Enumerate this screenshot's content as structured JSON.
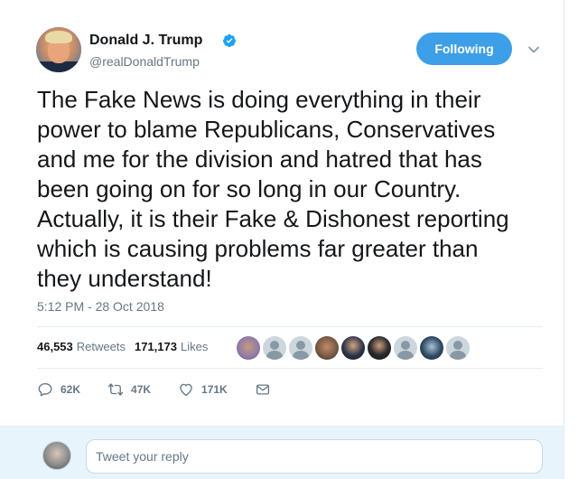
{
  "author": {
    "name": "Donald J. Trump",
    "handle": "@realDonaldTrump",
    "verified_icon": "verified-badge-icon"
  },
  "follow_button": {
    "label": "Following"
  },
  "tweet": {
    "lines": [
      "The Fake News is doing everything in their",
      "power to blame Republicans, Conservatives",
      "and me for the division and hatred that has",
      "been going on for so long in our Country.",
      "Actually, it is their Fake & Dishonest reporting",
      "which is causing problems far greater than",
      "they understand!"
    ],
    "timestamp": "5:12 PM - 28 Oct 2018"
  },
  "stats": {
    "retweets_count": "46,553",
    "retweets_label": "Retweets",
    "likes_count": "171,173",
    "likes_label": "Likes"
  },
  "actions": {
    "reply_count": "62K",
    "retweet_count": "47K",
    "like_count": "171K"
  },
  "reply": {
    "placeholder": "Tweet your reply"
  },
  "colors": {
    "accent": "#1da1f2",
    "follow_bg": "#3c9fe7",
    "muted": "#657786",
    "reply_bar_bg": "#e8f4fb"
  }
}
